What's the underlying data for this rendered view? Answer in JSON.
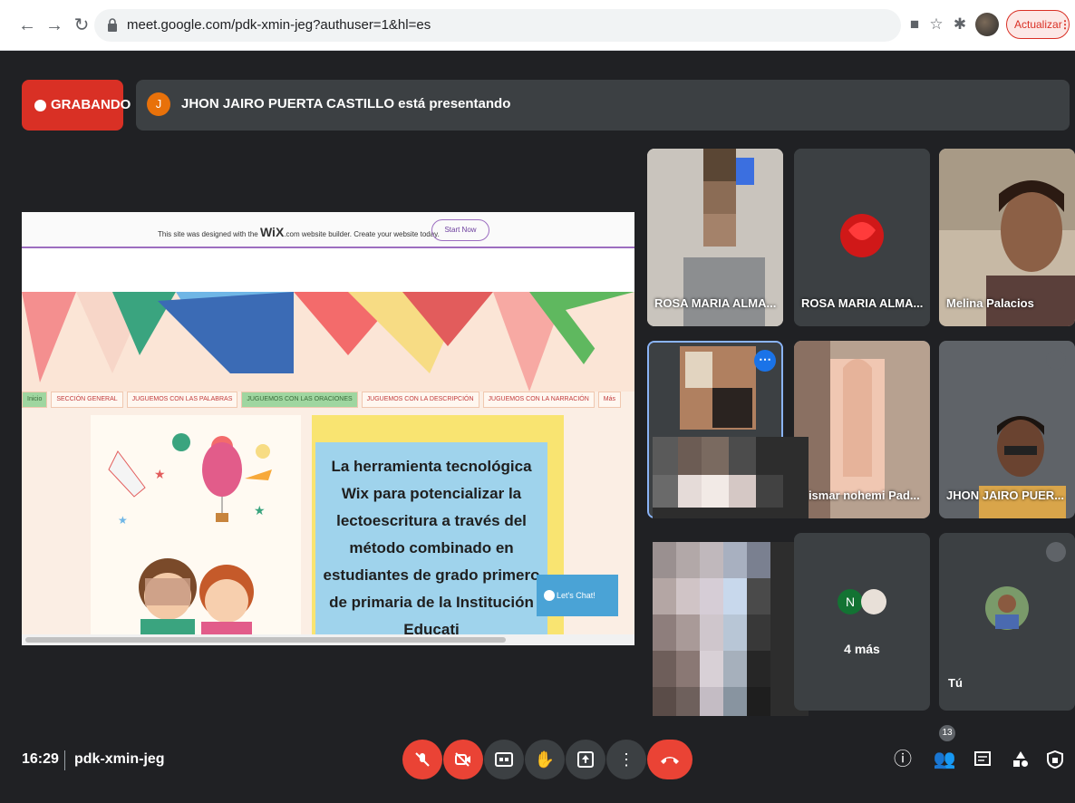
{
  "browser": {
    "url": "meet.google.com/pdk-xmin-jeg?authuser=1&hl=es",
    "update_label": "Actualizar"
  },
  "recording": {
    "label": "GRABANDO"
  },
  "presenter": {
    "initial": "J",
    "text": "JHON JAIRO PUERTA CASTILLO está presentando"
  },
  "presentation": {
    "wix_text_prefix": "This site was designed with the",
    "wix_logo": "WiX",
    "wix_text_suffix": ".com website builder. Create your website today.",
    "start_now": "Start Now",
    "nav_items": [
      "Inicio",
      "SECCIÓN GENERAL",
      "JUGUEMOS CON LAS PALABRAS",
      "JUGUEMOS CON LAS ORACIONES",
      "JUGUEMOS CON LA DESCRIPCIÓN",
      "JUGUEMOS CON LA NARRACIÓN",
      "Más"
    ],
    "title": "La herramienta tecnológica Wix para potencializar la lectoescritura a través del método combinado en estudiantes de grado primero de primaria de la Institución Educati",
    "chat_label": "Let's Chat!"
  },
  "participants": {
    "tile1_name": "ROSA MARIA ALMA...",
    "tile2_name": "ROSA MARIA ALMA...",
    "tile3_name": "Melina Palacios",
    "tile5_name": "Lismar nohemi Pad...",
    "tile6_name": "JHON JAIRO PUER...",
    "more_label": "4 más",
    "more_initial": "N",
    "you_label": "Tú"
  },
  "footer": {
    "time": "16:29",
    "meeting_code": "pdk-xmin-jeg",
    "participant_count": "13"
  },
  "colors": {
    "meet_bg": "#202124",
    "tile_bg": "#3c4043",
    "record_red": "#d93025",
    "end_call_red": "#ea4335"
  }
}
